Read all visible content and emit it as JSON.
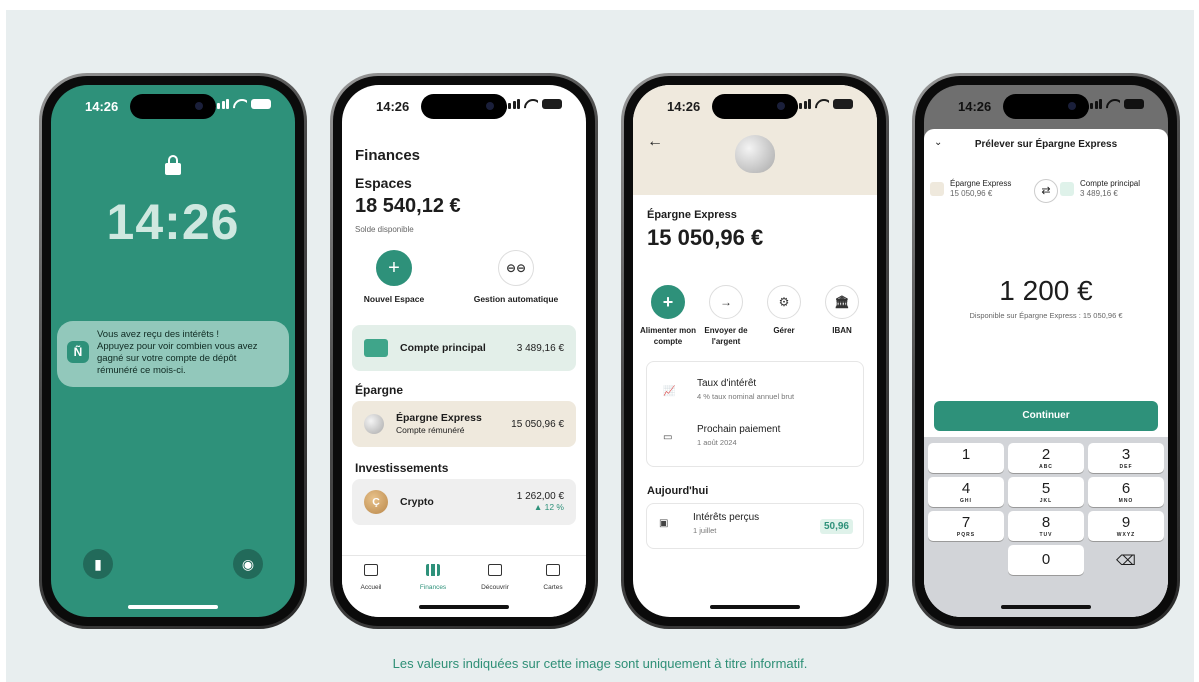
{
  "disclaimer": "Les valeurs indiquées sur cette image sont uniquement à titre informatif.",
  "status_time": "14:26",
  "lock_screen": {
    "clock": "14:26",
    "notification": {
      "title": "Vous avez reçu des intérêts !",
      "body": "Appuyez pour voir combien vous avez gagné sur votre compte de dépôt rémunéré ce mois-ci.",
      "app_icon": "Ñ"
    },
    "icons": [
      "flashlight-icon",
      "camera-icon"
    ]
  },
  "finances": {
    "title": "Finances",
    "spaces_label": "Espaces",
    "balance": "18 540,12 €",
    "balance_note": "Solde disponible",
    "actions": [
      {
        "label": "Nouvel Espace",
        "icon": "+"
      },
      {
        "label": "Gestion automatique",
        "icon": "⊖⊖"
      }
    ],
    "main_account": {
      "label": "Compte principal",
      "value": "3 489,16 €"
    },
    "savings_label": "Épargne",
    "savings_account": {
      "label": "Épargne Express",
      "sub": "Compte rémunéré",
      "value": "15 050,96 €"
    },
    "investments_label": "Investissements",
    "crypto": {
      "label": "Crypto",
      "value": "1 262,00 €",
      "change": "▲ 12 %"
    },
    "tabs": [
      "Accueil",
      "Finances",
      "Découvrir",
      "Cartes"
    ],
    "active_tab": "Finances"
  },
  "epargne": {
    "title": "Épargne Express",
    "balance": "15 050,96 €",
    "actions": [
      {
        "label": "Alimenter mon compte",
        "icon": "+"
      },
      {
        "label": "Envoyer de l'argent",
        "icon": "→"
      },
      {
        "label": "Gérer",
        "icon": "⚙"
      },
      {
        "label": "IBAN",
        "icon": "🏛"
      }
    ],
    "rate": {
      "title": "Taux d'intérêt",
      "sub": "4 % taux nominal annuel brut"
    },
    "next_payment": {
      "title": "Prochain paiement",
      "sub": "1 août 2024"
    },
    "today_label": "Aujourd'hui",
    "interest": {
      "title": "Intérêts perçus",
      "sub": "1 juillet",
      "value": "50,96"
    }
  },
  "transfer": {
    "title": "Prélever sur Épargne Express",
    "from": {
      "name": "Épargne Express",
      "amount": "15 050,96 €"
    },
    "to": {
      "name": "Compte principal",
      "amount": "3 489,16 €"
    },
    "amount": "1 200 €",
    "available": "Disponible sur Épargne Express : 15 050,96 €",
    "continue_label": "Continuer",
    "keys": [
      {
        "n": "1",
        "s": ""
      },
      {
        "n": "2",
        "s": "ABC"
      },
      {
        "n": "3",
        "s": "DEF"
      },
      {
        "n": "4",
        "s": "GHI"
      },
      {
        "n": "5",
        "s": "JKL"
      },
      {
        "n": "6",
        "s": "MNO"
      },
      {
        "n": "7",
        "s": "PQRS"
      },
      {
        "n": "8",
        "s": "TUV"
      },
      {
        "n": "9",
        "s": "WXYZ"
      },
      {
        "n": "0",
        "s": ""
      }
    ],
    "delete_icon": "⌫"
  },
  "colors": {
    "brand_green": "#2e917a",
    "savings_bg": "#efe9dd",
    "lock_bg": "#2e917a"
  }
}
